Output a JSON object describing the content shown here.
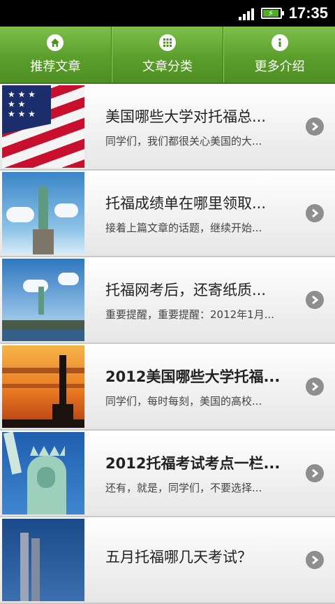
{
  "status_bar": {
    "time": "17:35"
  },
  "tabs": [
    {
      "label": "推荐文章",
      "icon": "home-icon"
    },
    {
      "label": "文章分类",
      "icon": "grid-icon"
    },
    {
      "label": "更多介绍",
      "icon": "info-icon"
    }
  ],
  "articles": [
    {
      "title": "美国哪些大学对托福总...",
      "snippet": "同学们，我们都很关心美国的大...",
      "thumb": "us-flag-thumbnail"
    },
    {
      "title": "托福成绩单在哪里领取...",
      "snippet": "接着上篇文章的话题，继续开始...",
      "thumb": "statue-of-liberty-thumbnail"
    },
    {
      "title": "托福网考后，还寄纸质...",
      "snippet": "重要提醒，重要提醒：2012年1月...",
      "thumb": "statue-of-liberty-island-thumbnail"
    },
    {
      "title": "2012美国哪些大学托福...",
      "snippet": "同学们，每时每刻，美国的高校...",
      "thumb": "statue-of-liberty-sunset-thumbnail"
    },
    {
      "title": "2012托福考试考点一栏...",
      "snippet": "还有，就是，同学们，不要选择...",
      "thumb": "statue-of-liberty-closeup-thumbnail"
    },
    {
      "title": "五月托福哪几天考试？",
      "snippet": "",
      "thumb": "city-towers-thumbnail"
    }
  ],
  "colors": {
    "tab_green": "#5a9e2c",
    "arrow_gray": "#8e8e8e"
  }
}
